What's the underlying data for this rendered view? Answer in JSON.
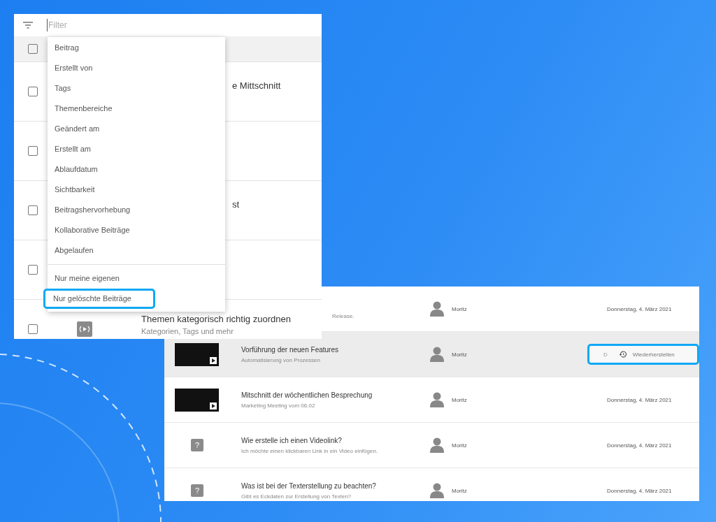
{
  "filter_panel": {
    "filter": {
      "placeholder": "Filter"
    },
    "header": {
      "checked": false
    },
    "rows": [
      {
        "checked": false,
        "title": "e Mittschnitt"
      },
      {
        "checked": false
      },
      {
        "checked": false,
        "title": "st"
      },
      {
        "checked": false
      },
      {
        "checked": false,
        "kind": "broadcast",
        "title": "Themen kategorisch richtig zuordnen",
        "subtitle": "Kategorien, Tags und mehr"
      }
    ],
    "menu": {
      "groups": [
        [
          {
            "label": "Beitrag",
            "selected": false
          },
          {
            "label": "Erstellt von",
            "selected": false
          },
          {
            "label": "Tags",
            "selected": false
          },
          {
            "label": "Themenbereiche",
            "selected": false
          },
          {
            "label": "Geändert am",
            "selected": false
          },
          {
            "label": "Erstellt am",
            "selected": false
          },
          {
            "label": "Ablaufdatum",
            "selected": false
          },
          {
            "label": "Sichtbarkeit",
            "selected": false
          },
          {
            "label": "Beitragshervorhebung",
            "selected": false
          },
          {
            "label": "Kollaborative Beiträge",
            "selected": false
          },
          {
            "label": "Abgelaufen",
            "selected": false
          }
        ],
        [
          {
            "label": "Nur meine eigenen",
            "selected": false
          },
          {
            "label": "Nur gelöschte Beiträge",
            "selected": true
          }
        ]
      ]
    }
  },
  "deleted_list": {
    "rows": [
      {
        "kind": "partial",
        "selected": false,
        "subtitle": "Release.",
        "author": "Moritz",
        "date": "Donnerstag, 4. März 2021"
      },
      {
        "kind": "video",
        "selected": true,
        "title": "Vorführung der neuen Features",
        "subtitle": "Automatisierung von Prozessen",
        "author": "Moritz",
        "action": {
          "hint": "D",
          "label": "Wiederherstellen"
        }
      },
      {
        "kind": "video",
        "selected": false,
        "title": "Mitschnitt der wöchentlichen Besprechung",
        "subtitle": "Marketing Meeting vom 06.02",
        "author": "Moritz",
        "date": "Donnerstag, 4. März 2021"
      },
      {
        "kind": "question",
        "icon": "?",
        "selected": false,
        "title": "Wie erstelle ich einen Videolink?",
        "subtitle": "Ich möchte einen klickbaren Link in ein Video einfügen.",
        "author": "Moritz",
        "date": "Donnerstag, 4. März 2021"
      },
      {
        "kind": "question",
        "icon": "?",
        "selected": false,
        "title": "Was ist bei der Texterstellung zu beachten?",
        "subtitle": "Gibt es Eckdaten zur Erstellung von Texten?",
        "author": "Moritz",
        "date": "Donnerstag, 4. März 2021"
      }
    ]
  }
}
